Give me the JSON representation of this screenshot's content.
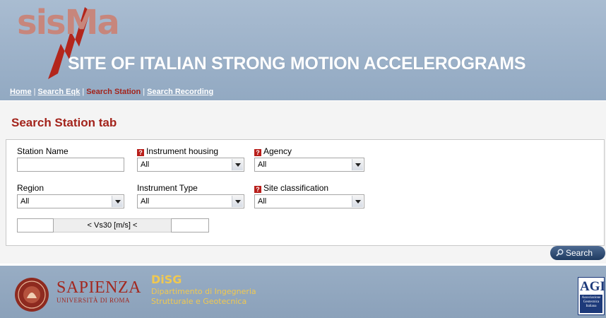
{
  "header": {
    "logo_text": "sisMa",
    "site_title": "SITE OF ITALIAN STRONG MOTION ACCELEROGRAMS",
    "nav": [
      {
        "label": "Home",
        "active": false
      },
      {
        "label": "Search Eqk",
        "active": false
      },
      {
        "label": "Search Station",
        "active": true
      },
      {
        "label": "Search Recording",
        "active": false
      }
    ],
    "nav_separator": "|"
  },
  "main": {
    "title": "Search Station tab",
    "form": {
      "station_name": {
        "label": "Station Name",
        "value": ""
      },
      "instrument_housing": {
        "label": "Instrument housing",
        "value": "All",
        "help_icon": "help-icon"
      },
      "agency": {
        "label": "Agency",
        "value": "All",
        "help_icon": "help-icon"
      },
      "region": {
        "label": "Region",
        "value": "All"
      },
      "instrument_type": {
        "label": "Instrument Type",
        "value": "All"
      },
      "site_classification": {
        "label": "Site classification",
        "value": "All",
        "help_icon": "help-icon"
      },
      "vs30": {
        "label": "< Vs30 [m/s] <",
        "min": "",
        "max": ""
      }
    },
    "search_button": "Search"
  },
  "footer": {
    "sapienza": "SAPIENZA",
    "sapienza_sub": "UNIVERSITÀ DI ROMA",
    "disg": "DiSG",
    "disg_line1": "Dipartimento di Ingegneria",
    "disg_line2": "Strutturale e Geotecnica",
    "agi_logo": "AGI",
    "agi_sub": "Associazione Geotecnica Italiana"
  },
  "colors": {
    "header_bg": "#a0b4ca",
    "accent_red": "#a3241c",
    "button_blue": "#2c4a73",
    "disg_gold": "#f0c850"
  }
}
